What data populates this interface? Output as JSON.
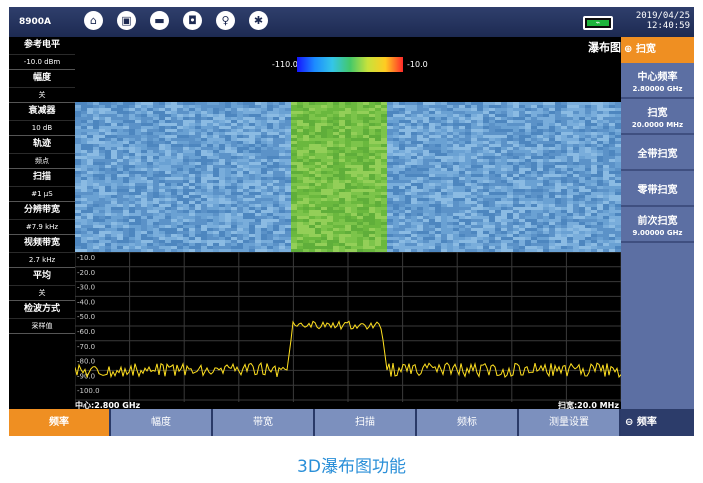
{
  "topbar": {
    "model": "8900A",
    "icons": [
      "home-icon",
      "folder-icon",
      "screen-icon",
      "save-icon",
      "bulb-icon",
      "settings-icon"
    ],
    "date": "2019/04/25",
    "time": "12:40:59"
  },
  "left_panel": [
    {
      "label": "参考电平",
      "value": "-10.0 dBm"
    },
    {
      "label": "幅度",
      "value": "关"
    },
    {
      "label": "衰减器",
      "value": "10 dB"
    },
    {
      "label": "轨迹",
      "value": "频点"
    },
    {
      "label": "扫描",
      "value": "#1 μS"
    },
    {
      "label": "分辨带宽",
      "value": "#7.9 kHz"
    },
    {
      "label": "视频带宽",
      "value": "2.7 kHz"
    },
    {
      "label": "平均",
      "value": "关"
    },
    {
      "label": "检波方式",
      "value": "采样值"
    }
  ],
  "waterfall": {
    "title": "瀑布图",
    "scale_min": "-110.0",
    "scale_max": "-10.0"
  },
  "spectrum": {
    "y_ticks": [
      "-10.0",
      "-20.0",
      "-30.0",
      "-40.0",
      "-50.0",
      "-60.0",
      "-70.0",
      "-80.0",
      "-90.0",
      "-100.0"
    ],
    "center": "中心:2.800 GHz",
    "span": "扫宽:20.0 MHz"
  },
  "right_panel": {
    "header": "扫宽",
    "buttons": [
      {
        "label": "中心频率",
        "value": "2.80000 GHz"
      },
      {
        "label": "扫宽",
        "value": "20.0000 MHz"
      },
      {
        "label": "全带扫宽",
        "value": ""
      },
      {
        "label": "零带扫宽",
        "value": ""
      },
      {
        "label": "前次扫宽",
        "value": "9.00000 GHz"
      }
    ]
  },
  "bottom_bar": {
    "tabs": [
      "频率",
      "幅度",
      "带宽",
      "扫描",
      "频标",
      "测量设置"
    ],
    "right": "频率"
  },
  "caption": "3D瀑布图功能",
  "colors": {
    "accent": "#ef8f22",
    "panel": "#5c6fa3",
    "trace": "#ffe020"
  }
}
